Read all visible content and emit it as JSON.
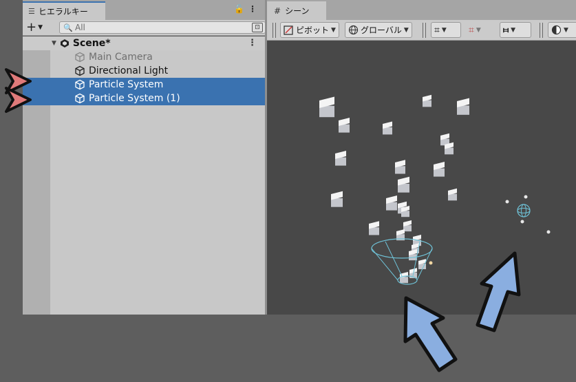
{
  "hierarchy": {
    "tab_label": "ヒエラルキー",
    "tab_icon": "list-icon",
    "lock_glyph": "🔓",
    "menu_glyph": "⋮",
    "add_glyph": "+",
    "search": {
      "placeholder": "All"
    },
    "scene": {
      "label": "Scene*",
      "menu_glyph": "⋮"
    },
    "items": [
      {
        "label": "Main Camera",
        "state": "disabled"
      },
      {
        "label": "Directional Light",
        "state": "normal"
      },
      {
        "label": "Particle System",
        "state": "selected"
      },
      {
        "label": "Particle System (1)",
        "state": "selected"
      }
    ]
  },
  "scene_view": {
    "tab_label": "シーン",
    "tab_icon": "grid-icon",
    "toolbar": {
      "pivot_label": "ピボット",
      "global_label": "グローバル"
    }
  },
  "colors": {
    "selection": "#3a72b0",
    "panel_bg": "#c8c8c8",
    "scene_bg": "#484848",
    "annotation_arrow": "#8aaee0",
    "annotation_marker": "#e07a7a",
    "gizmo": "#6fc3d8"
  }
}
